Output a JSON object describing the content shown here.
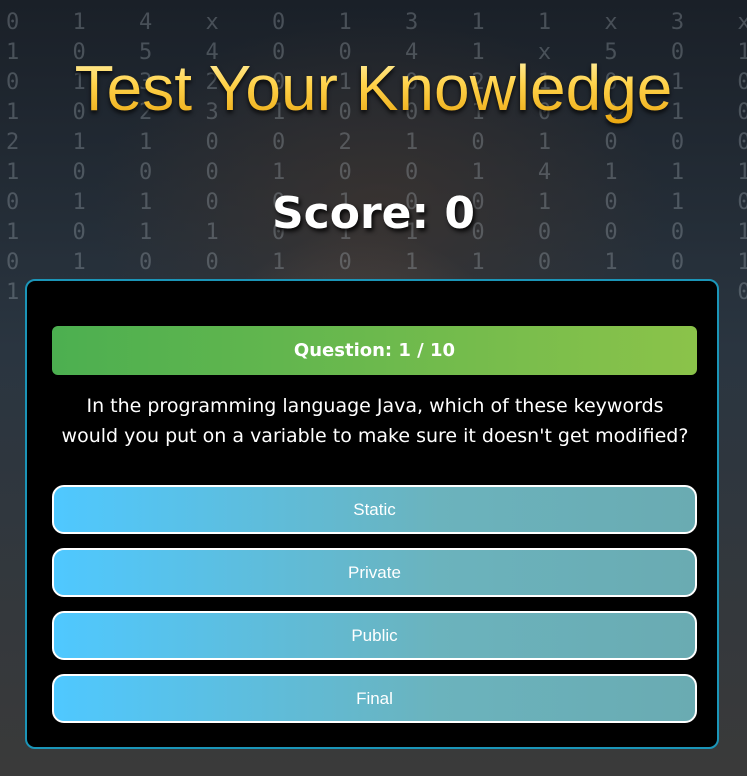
{
  "page": {
    "title": "Test Your Knowledge",
    "score_text": "Score: 0"
  },
  "quiz": {
    "question_counter": "Question: 1 / 10",
    "question_text": "In the programming language Java, which of these keywords would you put on a variable to make sure it doesn't get modified?",
    "answers": [
      "Static",
      "Private",
      "Public",
      "Final"
    ]
  },
  "colors": {
    "title_gold": "#f5c32a",
    "box_border": "#1b95b8",
    "header_green_start": "#4caf50",
    "header_green_end": "#8bc34a",
    "answer_blue_start": "#4fc8ff",
    "answer_blue_end": "#6aabb2"
  }
}
